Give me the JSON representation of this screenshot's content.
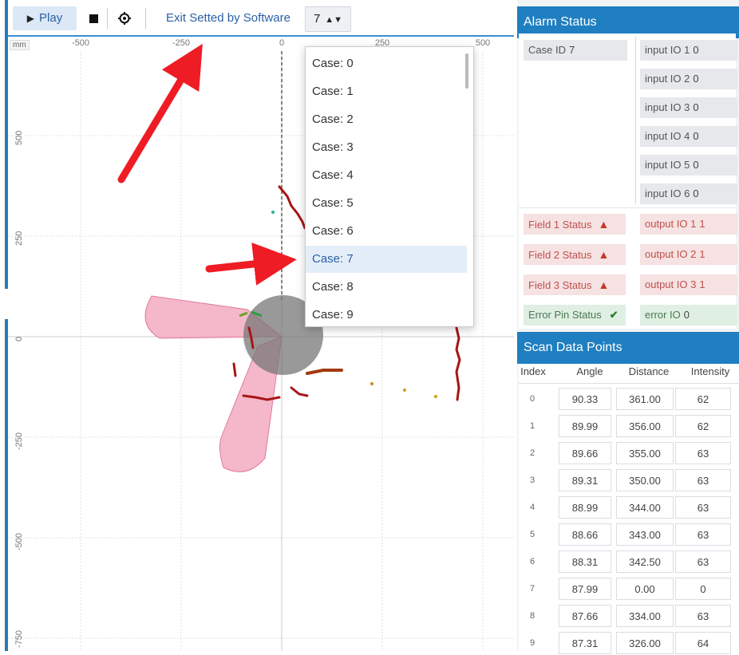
{
  "toolbar": {
    "play_label": "Play",
    "exit_label": "Exit Setted by Software",
    "case_value": "7"
  },
  "plot": {
    "unit_label": "mm",
    "x_ticks": [
      "-500",
      "-250",
      "0",
      "250",
      "500"
    ],
    "y_ticks": [
      "500",
      "250",
      "0",
      "-250",
      "-500",
      "-750"
    ]
  },
  "dropdown": {
    "options": [
      "Case: 0",
      "Case: 1",
      "Case: 2",
      "Case: 3",
      "Case: 4",
      "Case: 5",
      "Case: 6",
      "Case: 7",
      "Case: 8",
      "Case: 9"
    ],
    "selected": "Case: 7"
  },
  "alarm": {
    "title": "Alarm Status",
    "case_id_label": "Case ID",
    "case_id_value": "7",
    "inputs": [
      {
        "label": "input IO 1",
        "value": "0"
      },
      {
        "label": "input IO 2",
        "value": "0"
      },
      {
        "label": "input IO 3",
        "value": "0"
      },
      {
        "label": "input IO 4",
        "value": "0"
      },
      {
        "label": "input IO 5",
        "value": "0"
      },
      {
        "label": "input IO 6",
        "value": "0"
      }
    ],
    "fields": [
      {
        "label": "Field 1 Status"
      },
      {
        "label": "Field 2 Status"
      },
      {
        "label": "Field 3 Status"
      }
    ],
    "outputs": [
      {
        "label": "output IO 1",
        "value": "1"
      },
      {
        "label": "output IO 2",
        "value": "1"
      },
      {
        "label": "output IO 3",
        "value": "1"
      }
    ],
    "error_pin_label": "Error Pin Status",
    "error_io_label": "error IO",
    "error_io_value": "0"
  },
  "scan": {
    "title": "Scan Data Points",
    "headers": [
      "Index",
      "Angle",
      "Distance",
      "Intensity"
    ],
    "rows": [
      [
        "0",
        "90.33",
        "361.00",
        "62"
      ],
      [
        "1",
        "89.99",
        "356.00",
        "62"
      ],
      [
        "2",
        "89.66",
        "355.00",
        "63"
      ],
      [
        "3",
        "89.31",
        "350.00",
        "63"
      ],
      [
        "4",
        "88.99",
        "344.00",
        "63"
      ],
      [
        "5",
        "88.66",
        "343.00",
        "63"
      ],
      [
        "6",
        "88.31",
        "342.50",
        "63"
      ],
      [
        "7",
        "87.99",
        "0.00",
        "0"
      ],
      [
        "8",
        "87.66",
        "334.00",
        "63"
      ],
      [
        "9",
        "87.31",
        "326.00",
        "64"
      ]
    ]
  },
  "colors": {
    "accent": "#1f7fc0",
    "field_zone": "#f2a6bd",
    "alert": "#c0392b",
    "ok": "#2e7d32"
  }
}
